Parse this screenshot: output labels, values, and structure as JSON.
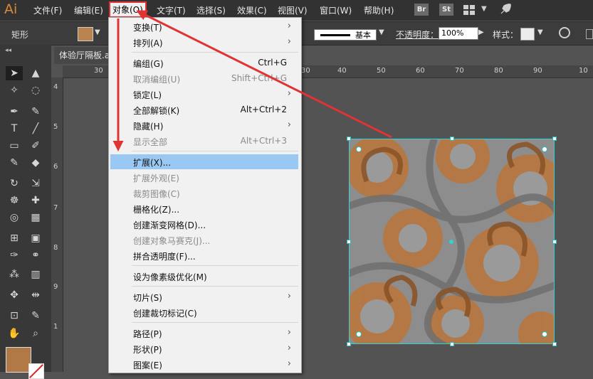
{
  "app": {
    "logo": "Ai"
  },
  "menubar": {
    "items": [
      "文件(F)",
      "编辑(E)",
      "对象(O)",
      "文字(T)",
      "选择(S)",
      "效果(C)",
      "视图(V)",
      "窗口(W)",
      "帮助(H)"
    ],
    "app_icons": [
      "Br",
      "St"
    ]
  },
  "controlbar": {
    "shape_label": "矩形",
    "stroke_profile": "基本",
    "opacity_label": "不透明度：",
    "opacity_value": "100%",
    "style_label": "样式："
  },
  "document": {
    "tab_title": "体验厅隔板.ai"
  },
  "ruler": {
    "top_ticks": [
      "30",
      "30",
      "40",
      "50",
      "60",
      "70",
      "80",
      "90",
      "10"
    ],
    "left_ticks": [
      "4",
      "5",
      "6",
      "7",
      "8",
      "9",
      "1"
    ]
  },
  "object_menu": {
    "items": [
      {
        "label": "变换(T)",
        "submenu": true
      },
      {
        "label": "排列(A)",
        "submenu": true
      },
      {
        "label": "编组(G)",
        "shortcut": "Ctrl+G"
      },
      {
        "label": "取消编组(U)",
        "shortcut": "Shift+Ctrl+G",
        "disabled": true
      },
      {
        "label": "锁定(L)",
        "submenu": true
      },
      {
        "label": "全部解锁(K)",
        "shortcut": "Alt+Ctrl+2"
      },
      {
        "label": "隐藏(H)",
        "submenu": true
      },
      {
        "label": "显示全部",
        "shortcut": "Alt+Ctrl+3",
        "disabled": true
      },
      {
        "label": "扩展(X)...",
        "highlighted": true
      },
      {
        "label": "扩展外观(E)",
        "disabled": true
      },
      {
        "label": "裁剪图像(C)",
        "disabled": true
      },
      {
        "label": "栅格化(Z)..."
      },
      {
        "label": "创建渐变网格(D)..."
      },
      {
        "label": "创建对象马赛克(J)...",
        "disabled": true
      },
      {
        "label": "拼合透明度(F)..."
      },
      {
        "label": "设为像素级优化(M)"
      },
      {
        "label": "切片(S)",
        "submenu": true
      },
      {
        "label": "创建裁切标记(C)"
      },
      {
        "label": "路径(P)",
        "submenu": true
      },
      {
        "label": "形状(P)",
        "submenu": true
      },
      {
        "label": "图案(E)",
        "submenu": true
      }
    ]
  },
  "colors": {
    "menu_highlight": "#99c9f2",
    "annotation_red": "#e03434",
    "selection_cyan": "#30d2d2",
    "pattern_orange": "#b7773f"
  }
}
